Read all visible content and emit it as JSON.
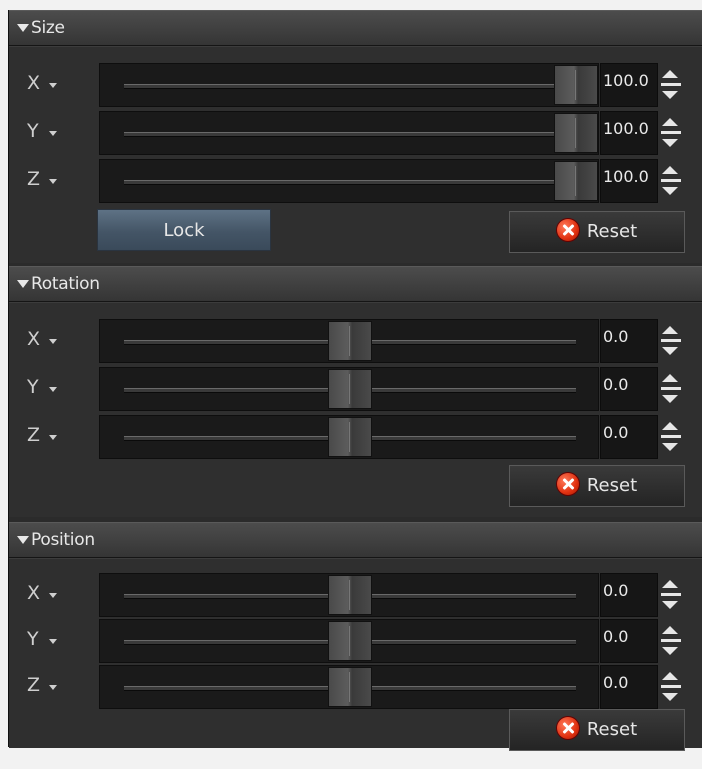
{
  "sections": {
    "size": {
      "title": "Size",
      "rows": [
        {
          "axis": "X",
          "value": "100.0",
          "fraction": 1.0
        },
        {
          "axis": "Y",
          "value": "100.0",
          "fraction": 1.0
        },
        {
          "axis": "Z",
          "value": "100.0",
          "fraction": 1.0
        }
      ],
      "lock_label": "Lock",
      "reset_label": "Reset"
    },
    "rotation": {
      "title": "Rotation",
      "rows": [
        {
          "axis": "X",
          "value": "0.0",
          "fraction": 0.5
        },
        {
          "axis": "Y",
          "value": "0.0",
          "fraction": 0.5
        },
        {
          "axis": "Z",
          "value": "0.0",
          "fraction": 0.5
        }
      ],
      "reset_label": "Reset"
    },
    "position": {
      "title": "Position",
      "rows": [
        {
          "axis": "X",
          "value": "0.0",
          "fraction": 0.5
        },
        {
          "axis": "Y",
          "value": "0.0",
          "fraction": 0.5
        },
        {
          "axis": "Z",
          "value": "0.0",
          "fraction": 0.5
        }
      ],
      "reset_label": "Reset"
    }
  },
  "icons": {
    "collapse": "triangle-down-icon",
    "axis_menu": "caret-down-icon",
    "spinner": "spin-up-down-icon",
    "reset": "red-x-circle-icon"
  },
  "colors": {
    "panel_bg": "#2f2f2f",
    "header_bg": "#404040",
    "lock_button": "#4e6072",
    "reset_icon": "#e03010"
  }
}
